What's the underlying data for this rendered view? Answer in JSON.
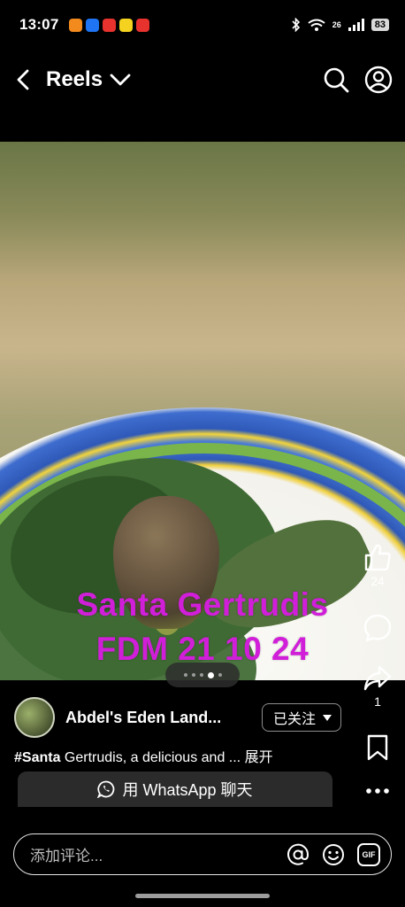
{
  "status_bar": {
    "time": "13:07",
    "battery": "83",
    "network": "26",
    "app_icon_colors": [
      "#f28a1e",
      "#1e74f2",
      "#e8322e",
      "#f4d21f",
      "#e8322e"
    ]
  },
  "header": {
    "title": "Reels",
    "icons": [
      "back-icon",
      "chevron-down-icon",
      "search-icon",
      "profile-icon"
    ]
  },
  "post": {
    "overlay_line1": "Santa Gertrudis",
    "overlay_line2": "FDM 21 10 24",
    "overlay_color": "#d11fd9",
    "carousel": {
      "count": 5,
      "active_index": 3
    },
    "author_name": "Abdel's Eden Land...",
    "follow_label": "已关注",
    "caption_hashtag": "#Santa",
    "caption_text": " Gertrudis, a delicious and ...",
    "caption_more": "展开",
    "whatsapp_label": "用 WhatsApp 聊天"
  },
  "side_actions": {
    "like_count": "24",
    "share_count": "1"
  },
  "comment_bar": {
    "placeholder": "添加评论...",
    "gif_label": "GIF"
  }
}
